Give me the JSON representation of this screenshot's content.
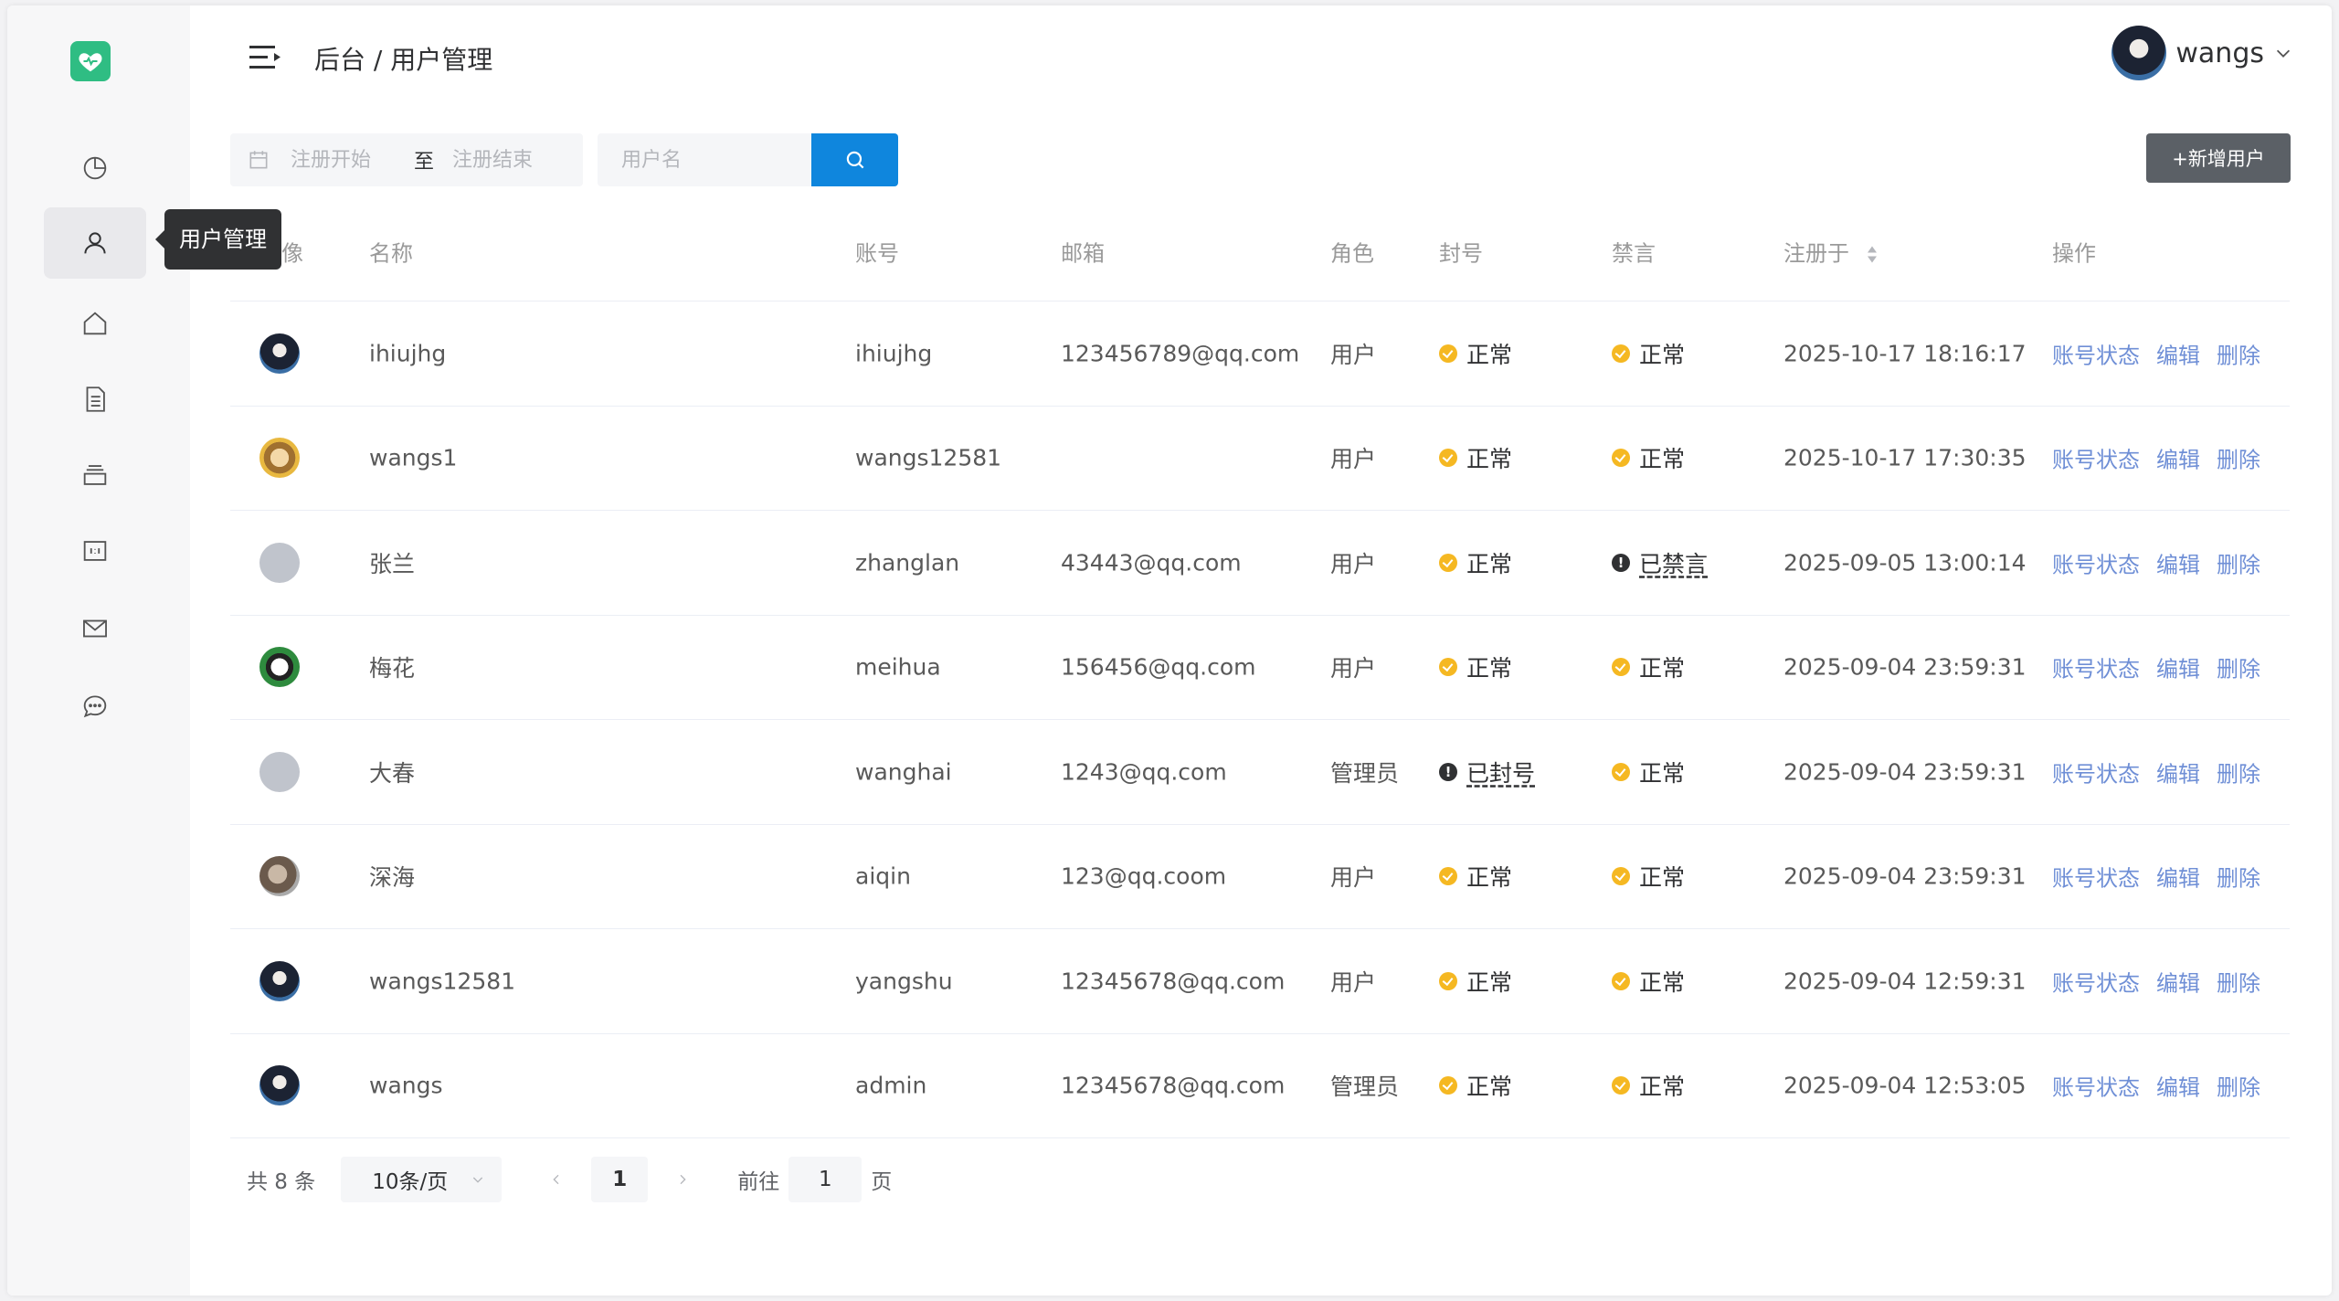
{
  "header": {
    "breadcrumb": "后台 / 用户管理",
    "user_name": "wangs"
  },
  "sidebar": {
    "items": [
      {
        "name": "dashboard",
        "icon": "pie-chart-icon"
      },
      {
        "name": "users",
        "icon": "user-icon",
        "active": true
      },
      {
        "name": "home",
        "icon": "home-icon"
      },
      {
        "name": "articles",
        "icon": "document-icon"
      },
      {
        "name": "categories",
        "icon": "layers-icon"
      },
      {
        "name": "media",
        "icon": "image-frame-icon"
      },
      {
        "name": "messages",
        "icon": "mail-icon"
      },
      {
        "name": "comments",
        "icon": "chat-icon"
      }
    ],
    "tooltip": "用户管理"
  },
  "filters": {
    "start_placeholder": "注册开始",
    "separator": "至",
    "end_placeholder": "注册结束",
    "username_placeholder": "用户名",
    "add_button": "+新增用户"
  },
  "table": {
    "headers": {
      "avatar": "头像",
      "name": "名称",
      "account": "账号",
      "email": "邮箱",
      "role": "角色",
      "ban": "封号",
      "mute": "禁言",
      "registered": "注册于",
      "ops": "操作"
    },
    "rows": [
      {
        "avatar": "dark",
        "name": "ihiujhg",
        "account": "ihiujhg",
        "email": "123456789@qq.com",
        "role": "用户",
        "ban": "正常",
        "ban_ok": true,
        "mute": "正常",
        "mute_ok": true,
        "registered": "2025-10-17 18:16:17"
      },
      {
        "avatar": "gold",
        "name": "wangs1",
        "account": "wangs12581",
        "email": "",
        "role": "用户",
        "ban": "正常",
        "ban_ok": true,
        "mute": "正常",
        "mute_ok": true,
        "registered": "2025-10-17 17:30:35"
      },
      {
        "avatar": "grey",
        "name": "张兰",
        "account": "zhanglan",
        "email": "43443@qq.com",
        "role": "用户",
        "ban": "正常",
        "ban_ok": true,
        "mute": "已禁言",
        "mute_ok": false,
        "registered": "2025-09-05 13:00:14"
      },
      {
        "avatar": "panda",
        "name": "梅花",
        "account": "meihua",
        "email": "156456@qq.com",
        "role": "用户",
        "ban": "正常",
        "ban_ok": true,
        "mute": "正常",
        "mute_ok": true,
        "registered": "2025-09-04 23:59:31"
      },
      {
        "avatar": "grey",
        "name": "大春",
        "account": "wanghai",
        "email": "1243@qq.com",
        "role": "管理员",
        "ban": "已封号",
        "ban_ok": false,
        "mute": "正常",
        "mute_ok": true,
        "registered": "2025-09-04 23:59:31"
      },
      {
        "avatar": "animal",
        "name": "深海",
        "account": "aiqin",
        "email": "123@qq.coom",
        "role": "用户",
        "ban": "正常",
        "ban_ok": true,
        "mute": "正常",
        "mute_ok": true,
        "registered": "2025-09-04 23:59:31"
      },
      {
        "avatar": "dark",
        "name": "wangs12581",
        "account": "yangshu",
        "email": "12345678@qq.com",
        "role": "用户",
        "ban": "正常",
        "ban_ok": true,
        "mute": "正常",
        "mute_ok": true,
        "registered": "2025-09-04 12:59:31"
      },
      {
        "avatar": "dark",
        "name": "wangs",
        "account": "admin",
        "email": "12345678@qq.com",
        "role": "管理员",
        "ban": "正常",
        "ban_ok": true,
        "mute": "正常",
        "mute_ok": true,
        "registered": "2025-09-04 12:53:05"
      }
    ],
    "ops": {
      "status": "账号状态",
      "edit": "编辑",
      "delete": "删除"
    }
  },
  "pagination": {
    "total": "共 8 条",
    "page_size": "10条/页",
    "current_page": "1",
    "goto_label": "前往",
    "goto_value": "1",
    "goto_suffix": "页"
  },
  "colors": {
    "accent": "#0f86dd",
    "logo": "#2fbd83",
    "status_ok": "#f5b822",
    "link": "#6f8fd6"
  }
}
